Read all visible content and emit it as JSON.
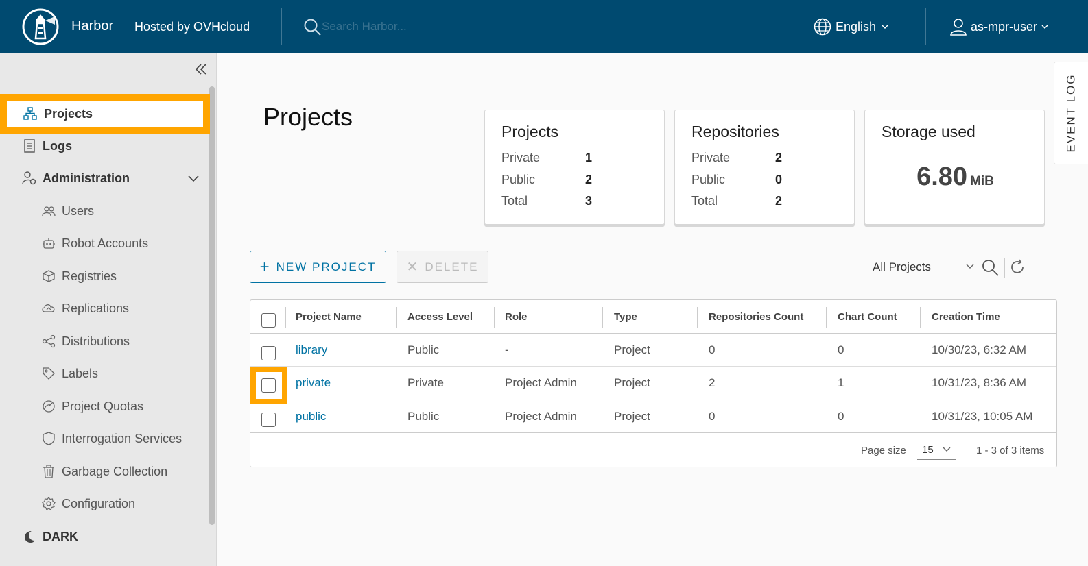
{
  "header": {
    "brand": "Harbor",
    "hosted_by": "Hosted by OVHcloud",
    "search_placeholder": "Search Harbor...",
    "language": "English",
    "user": "as-mpr-user",
    "bg_color": "#004a70"
  },
  "sidebar": {
    "items": [
      {
        "label": "Projects",
        "icon": "projects-icon",
        "active": true
      },
      {
        "label": "Logs",
        "icon": "logs-icon"
      },
      {
        "label": "Administration",
        "icon": "administration-icon",
        "expanded": true
      },
      {
        "label": "Users",
        "icon": "users-icon"
      },
      {
        "label": "Robot Accounts",
        "icon": "robot-icon"
      },
      {
        "label": "Registries",
        "icon": "registries-icon"
      },
      {
        "label": "Replications",
        "icon": "replications-icon"
      },
      {
        "label": "Distributions",
        "icon": "distributions-icon"
      },
      {
        "label": "Labels",
        "icon": "labels-icon"
      },
      {
        "label": "Project Quotas",
        "icon": "quota-icon"
      },
      {
        "label": "Interrogation Services",
        "icon": "shield-icon"
      },
      {
        "label": "Garbage Collection",
        "icon": "trash-icon"
      },
      {
        "label": "Configuration",
        "icon": "gear-icon"
      },
      {
        "label": "DARK",
        "icon": "moon-icon"
      }
    ],
    "highlight_color": "#ffa500"
  },
  "main": {
    "title": "Projects",
    "cards": {
      "projects": {
        "title": "Projects",
        "rows": [
          {
            "label": "Private",
            "value": "1"
          },
          {
            "label": "Public",
            "value": "2"
          },
          {
            "label": "Total",
            "value": "3"
          }
        ]
      },
      "repositories": {
        "title": "Repositories",
        "rows": [
          {
            "label": "Private",
            "value": "2"
          },
          {
            "label": "Public",
            "value": "0"
          },
          {
            "label": "Total",
            "value": "2"
          }
        ]
      },
      "storage": {
        "title": "Storage used",
        "value": "6.80",
        "unit": "MiB"
      }
    },
    "event_log": "EVENT LOG",
    "new_project": "NEW PROJECT",
    "delete": "DELETE",
    "filter": "All Projects",
    "accent_color": "#0072a3"
  },
  "table": {
    "columns": [
      "Project Name",
      "Access Level",
      "Role",
      "Type",
      "Repositories Count",
      "Chart Count",
      "Creation Time"
    ],
    "rows": [
      {
        "name": "library",
        "access": "Public",
        "role": "-",
        "type": "Project",
        "repos": "0",
        "charts": "0",
        "created": "10/30/23, 6:32 AM"
      },
      {
        "name": "private",
        "access": "Private",
        "role": "Project Admin",
        "type": "Project",
        "repos": "2",
        "charts": "1",
        "created": "10/31/23, 8:36 AM"
      },
      {
        "name": "public",
        "access": "Public",
        "role": "Project Admin",
        "type": "Project",
        "repos": "0",
        "charts": "0",
        "created": "10/31/23, 10:05 AM"
      }
    ],
    "page_size_label": "Page size",
    "page_size": "15",
    "items_info": "1 - 3 of 3 items"
  }
}
